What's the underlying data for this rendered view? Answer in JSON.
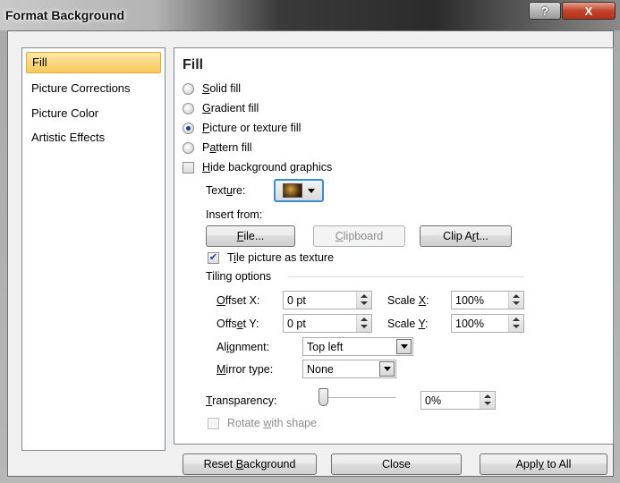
{
  "window": {
    "title": "Format Background",
    "help_label": "?",
    "close_label": "X"
  },
  "nav": {
    "items": [
      {
        "label": "Fill",
        "selected": true
      },
      {
        "label": "Picture Corrections",
        "selected": false
      },
      {
        "label": "Picture Color",
        "selected": false
      },
      {
        "label": "Artistic Effects",
        "selected": false
      }
    ]
  },
  "fill": {
    "title": "Fill",
    "options": [
      {
        "prefix": "",
        "accel": "S",
        "rest": "olid fill",
        "checked": false
      },
      {
        "prefix": "",
        "accel": "G",
        "rest": "radient fill",
        "checked": false
      },
      {
        "prefix": "",
        "accel": "P",
        "rest": "icture or texture fill",
        "checked": true
      },
      {
        "prefix": "P",
        "accel": "a",
        "rest": "ttern fill",
        "checked": false
      }
    ],
    "hide_graphics": {
      "prefix": "",
      "accel": "H",
      "rest": "ide background graphics",
      "checked": false
    },
    "texture": {
      "prefix": "Text",
      "accel": "u",
      "rest": "re:",
      "icon": "texture-swatch"
    },
    "insert_from_label": "Insert from:",
    "buttons": {
      "file": {
        "prefix": "",
        "accel": "F",
        "rest": "ile..."
      },
      "clipboard": {
        "prefix": "",
        "accel": "C",
        "rest": "lipboard"
      },
      "clip_art": {
        "prefix": "Clip A",
        "accel": "r",
        "rest": "t..."
      }
    },
    "tile": {
      "prefix": "T",
      "accel": "i",
      "rest": "le picture as texture",
      "checked": true
    },
    "tiling_options_label": "Tiling options",
    "offset_x": {
      "prefix": "",
      "accel": "O",
      "rest": "ffset X:",
      "value": "0 pt"
    },
    "offset_y": {
      "prefix": "Offs",
      "accel": "e",
      "rest": "t Y:",
      "value": "0 pt"
    },
    "scale_x": {
      "prefix": "Scale ",
      "accel": "X",
      "rest": ":",
      "value": "100%"
    },
    "scale_y": {
      "prefix": "Scale ",
      "accel": "Y",
      "rest": ":",
      "value": "100%"
    },
    "alignment": {
      "prefix": "Al",
      "accel": "i",
      "rest": "gnment:",
      "value": "Top left"
    },
    "mirror": {
      "prefix": "",
      "accel": "M",
      "rest": "irror type:",
      "value": "None"
    },
    "transparency": {
      "prefix": "",
      "accel": "T",
      "rest": "ransparency:",
      "value": "0%",
      "level": 0
    },
    "rotate": {
      "prefix": "Rotate ",
      "accel": "w",
      "rest": "ith shape",
      "checked": false,
      "disabled": true
    }
  },
  "footer": {
    "reset": {
      "prefix": "Reset ",
      "accel": "B",
      "rest": "ackground"
    },
    "close": "Close",
    "apply_all": {
      "prefix": "Appl",
      "accel": "y",
      "rest": " to All"
    }
  }
}
